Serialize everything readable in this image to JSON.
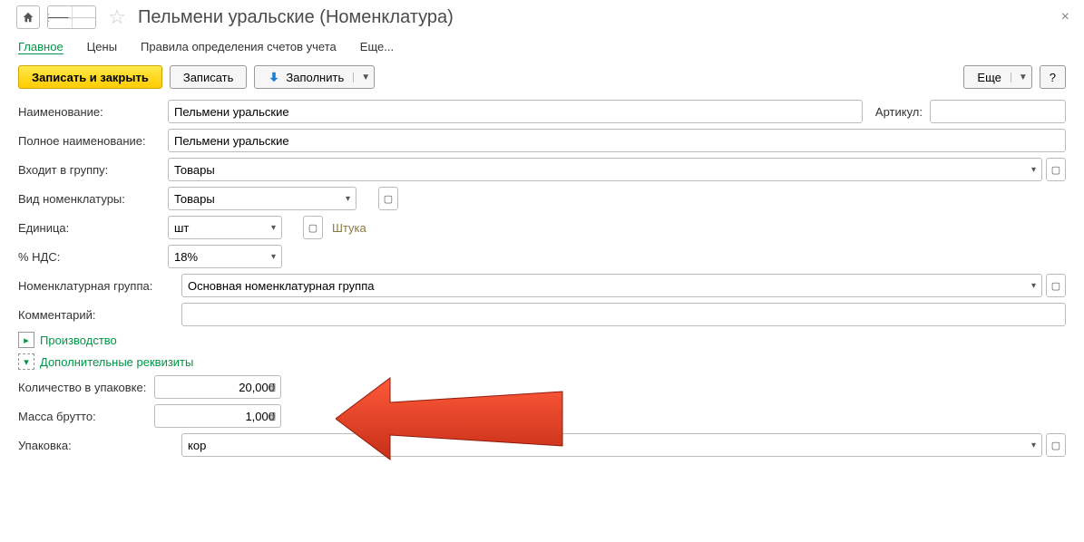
{
  "header": {
    "title": "Пельмени уральские (Номенклатура)"
  },
  "tabs": {
    "main": "Главное",
    "prices": "Цены",
    "accounts": "Правила определения счетов учета",
    "more": "Еще..."
  },
  "toolbar": {
    "save_close": "Записать и закрыть",
    "save": "Записать",
    "fill": "Заполнить",
    "more": "Еще",
    "help": "?"
  },
  "labels": {
    "name": "Наименование:",
    "article": "Артикул:",
    "full_name": "Полное наименование:",
    "group": "Входит в группу:",
    "kind": "Вид номенклатуры:",
    "unit": "Единица:",
    "unit_hint": "Штука",
    "vat": "% НДС:",
    "nom_group": "Номенклатурная группа:",
    "comment": "Комментарий:",
    "sec_production": "Производство",
    "sec_additional": "Дополнительные реквизиты",
    "qty_pack": "Количество в упаковке:",
    "gross": "Масса брутто:",
    "package": "Упаковка:"
  },
  "values": {
    "name": "Пельмени уральские",
    "article": "",
    "full_name": "Пельмени уральские",
    "group": "Товары",
    "kind": "Товары",
    "unit": "шт",
    "vat": "18%",
    "nom_group": "Основная номенклатурная группа",
    "comment": "",
    "qty_pack": "20,000",
    "gross": "1,000",
    "package": "кор"
  }
}
